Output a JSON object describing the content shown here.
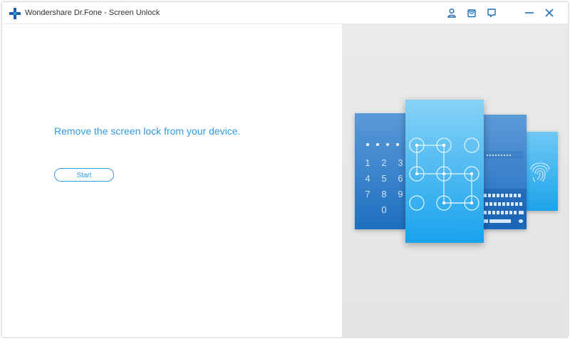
{
  "window": {
    "title": "Wondershare Dr.Fone - Screen Unlock",
    "accent_color": "#2f9be0",
    "icons": [
      "plus-logo-icon",
      "user-icon",
      "bag-icon",
      "chat-icon",
      "minimize-icon",
      "close-icon"
    ]
  },
  "main": {
    "headline": "Remove the screen lock from your device.",
    "start_label": "Start"
  },
  "illustration": {
    "keypad_digits": [
      "1",
      "2",
      "3",
      "4",
      "5",
      "6",
      "7",
      "8",
      "9",
      "0"
    ]
  }
}
